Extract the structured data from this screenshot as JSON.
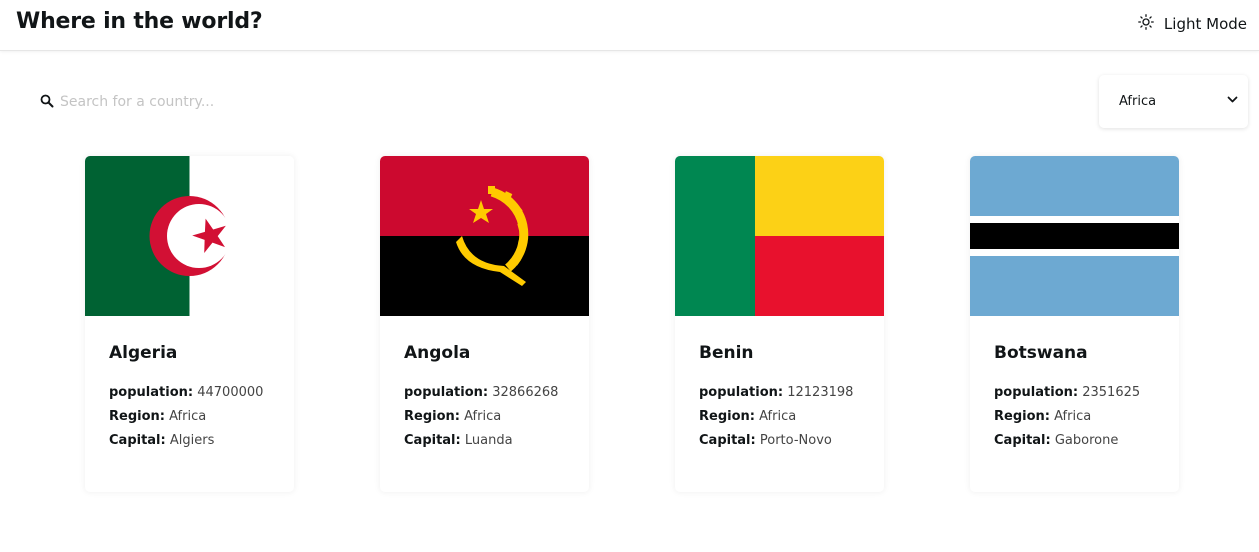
{
  "header": {
    "title": "Where in the world?",
    "theme_icon": "sun-icon",
    "theme_label": "Light Mode"
  },
  "search": {
    "icon": "search-icon",
    "placeholder": "Search for a country..."
  },
  "filter": {
    "selected": "Africa",
    "icon": "chevron-down-icon"
  },
  "labels": {
    "population": "population:",
    "region": "Region:",
    "capital": "Capital:"
  },
  "countries": [
    {
      "name": "Algeria",
      "population": "44700000",
      "region": "Africa",
      "capital": "Algiers",
      "flag": "algeria-flag"
    },
    {
      "name": "Angola",
      "population": "32866268",
      "region": "Africa",
      "capital": "Luanda",
      "flag": "angola-flag"
    },
    {
      "name": "Benin",
      "population": "12123198",
      "region": "Africa",
      "capital": "Porto-Novo",
      "flag": "benin-flag"
    },
    {
      "name": "Botswana",
      "population": "2351625",
      "region": "Africa",
      "capital": "Gaborone",
      "flag": "botswana-flag"
    }
  ],
  "colors": {
    "text": "#111517",
    "background": "#ffffff",
    "algeria_green": "#006233",
    "algeria_red": "#d21034",
    "angola_red": "#cc092f",
    "angola_gold": "#ffcb00",
    "benin_green": "#008751",
    "benin_yellow": "#fcd116",
    "benin_red": "#e8112d",
    "botswana_blue": "#6da9d2"
  }
}
